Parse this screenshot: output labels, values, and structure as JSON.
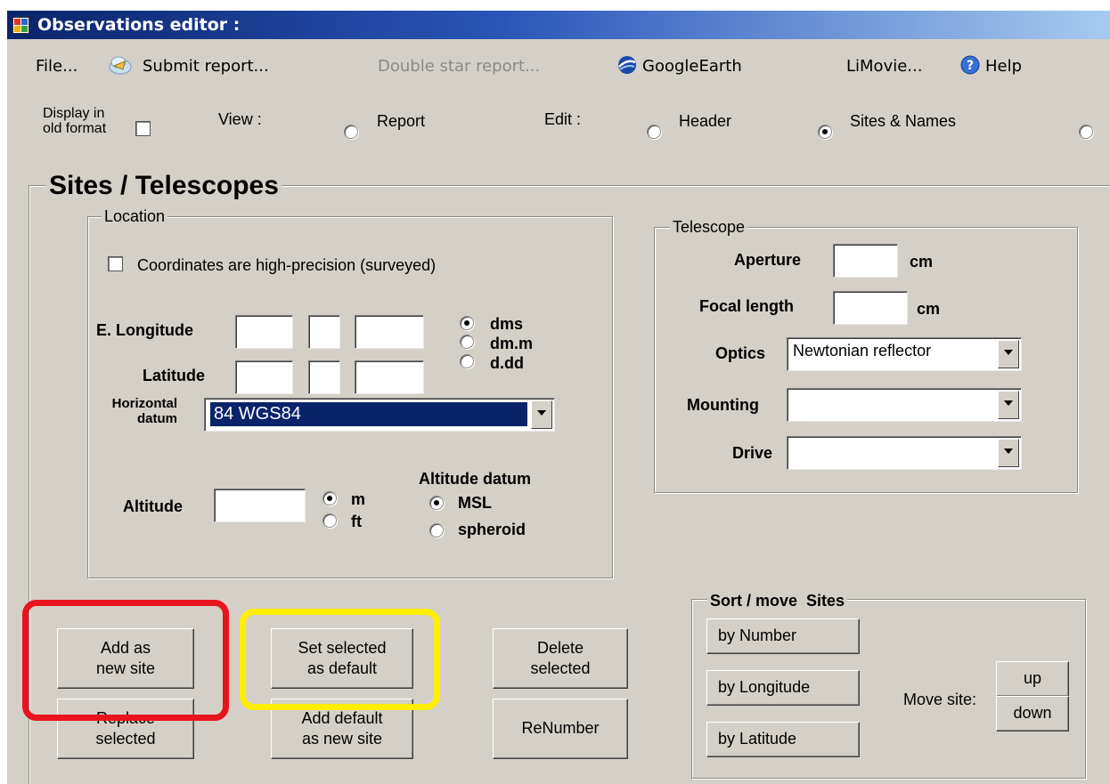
{
  "window": {
    "title": "Observations editor :"
  },
  "menu": {
    "file": "File...",
    "submit_report": "Submit report...",
    "double_star_report": "Double star report...",
    "google_earth": "GoogleEarth",
    "limovie": "LiMovie...",
    "help": "Help"
  },
  "toolbar": {
    "display_old_format_line1": "Display in",
    "display_old_format_line2": "old format",
    "view_label": "View :",
    "view_report": "Report",
    "edit_label": "Edit :",
    "edit_header": "Header",
    "edit_sites_names": "Sites & Names"
  },
  "sites_section": {
    "title": "Sites / Telescopes",
    "location": {
      "legend": "Location",
      "high_precision": "Coordinates are high-precision (surveyed)",
      "e_longitude": "E. Longitude",
      "latitude": "Latitude",
      "format_options": [
        "dms",
        "dm.m",
        "d.dd"
      ],
      "selected_format": "dms",
      "horizontal_datum_line1": "Horizontal",
      "horizontal_datum_line2": "datum",
      "horizontal_datum_value": "84  WGS84",
      "altitude": "Altitude",
      "altitude_units": [
        "m",
        "ft"
      ],
      "selected_unit": "m",
      "altitude_datum_label": "Altitude datum",
      "altitude_datum_options": [
        "MSL",
        "spheroid"
      ],
      "selected_altitude_datum": "MSL"
    },
    "telescope": {
      "legend": "Telescope",
      "aperture": "Aperture",
      "aperture_unit": "cm",
      "focal_length": "Focal length",
      "focal_unit": "cm",
      "optics": "Optics",
      "optics_value": "Newtonian reflector",
      "mounting": "Mounting",
      "drive": "Drive"
    },
    "buttons": {
      "add_new_site": "Add as\nnew site",
      "replace_selected": "Replace\nselected",
      "set_default": "Set selected\nas default",
      "add_default": "Add default\nas new site",
      "delete_selected": "Delete\nselected",
      "renumber": "ReNumber"
    },
    "sort": {
      "legend": "Sort / move  Sites",
      "by_number": "by Number",
      "by_longitude": "by Longitude",
      "by_latitude": "by Latitude",
      "move_site": "Move site:",
      "up": "up",
      "down": "down"
    }
  },
  "highlights": {
    "red": "#e8141c",
    "yellow": "#ffee00"
  }
}
